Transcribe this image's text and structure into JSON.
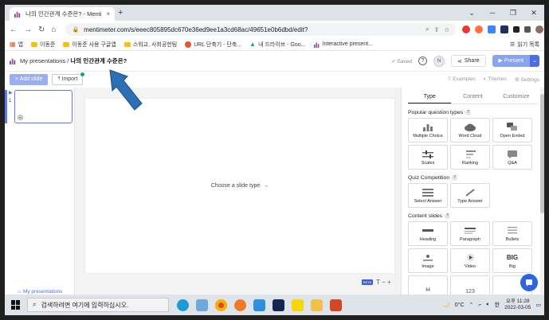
{
  "browser": {
    "tab_title": "나의 인간관계 수준은? - Mentim",
    "tab_close": "×",
    "new_tab": "+",
    "url": "mentimeter.com/s/eeec805895dc670e36ed9ee1a3cd68ac/49651e0b6dbd/edit?",
    "window_controls": [
      "⌄",
      "─",
      "❐",
      "✕"
    ],
    "bookmarks": [
      "앱",
      "이동준",
      "이동준 사용 구글앱",
      "스워교, 사회공헌팀",
      "URL 단축기 - 단축...",
      "내 드라이브 - Goo...",
      "Interactive present..."
    ],
    "reading_list": "읽기 목록"
  },
  "header": {
    "crumb_root": "My presentations",
    "crumb_sep": "/",
    "crumb_title": "나의 인간관계 수준은?",
    "saved": "Saved",
    "help": "?",
    "avatar": "N",
    "share": "Share",
    "present": "Present"
  },
  "subbar": {
    "add_slide": "+ Add slide",
    "import": "Import",
    "examples": "Examples",
    "themes": "Themes",
    "settings": "Settings"
  },
  "slides": {
    "number": "1",
    "avatar": "N",
    "my_presentations": "My presentations"
  },
  "canvas": {
    "choose": "Choose a slide type",
    "beta": "BETA",
    "tools": "T − +"
  },
  "panel": {
    "tabs": [
      "Type",
      "Content",
      "Customize"
    ],
    "popular_title": "Popular question types",
    "popular": [
      "Multiple Choice",
      "Word Cloud",
      "Open Ended",
      "Scales",
      "Ranking",
      "Q&A"
    ],
    "quiz_title": "Quiz Competition",
    "quiz": [
      "Select Answer",
      "Type Answer"
    ],
    "content_title": "Content slides",
    "content": [
      "Heading",
      "Paragraph",
      "Bullets",
      "Image",
      "Video",
      "Big"
    ],
    "big_text": "BIG",
    "more_number": "123"
  },
  "taskbar": {
    "search": "검색하려면 여기에 입력하십시오.",
    "temp": "0°C",
    "lang": "한",
    "time": "오후 11:28",
    "date": "2022-03-05"
  }
}
